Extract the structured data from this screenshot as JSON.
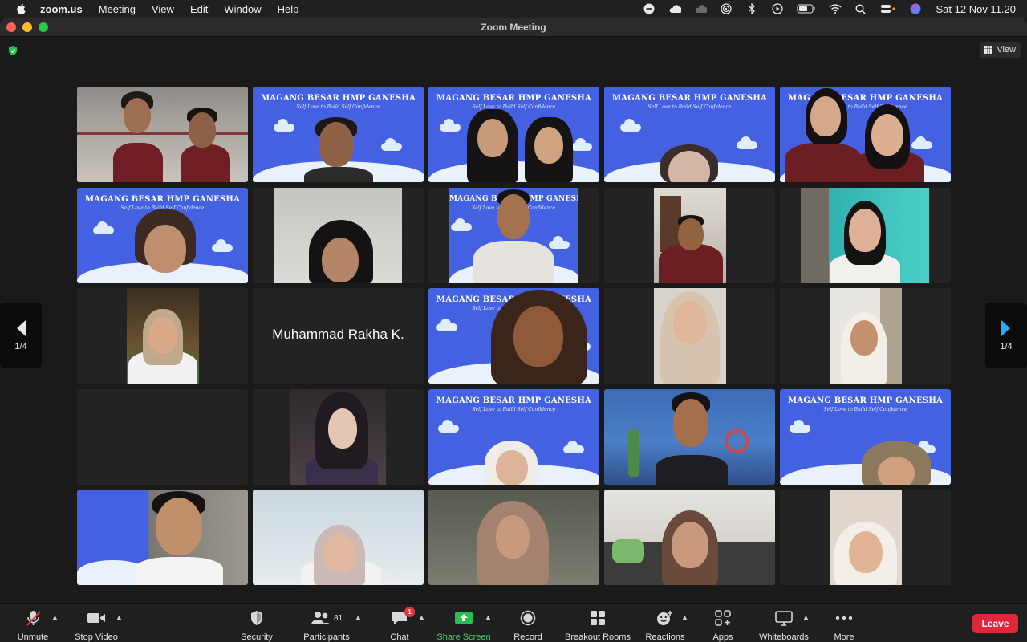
{
  "menubar": {
    "app_name": "zoom.us",
    "items": [
      "Meeting",
      "View",
      "Edit",
      "Window",
      "Help"
    ],
    "clock": "Sat 12 Nov  11.20"
  },
  "window": {
    "title": "Zoom Meeting"
  },
  "view_button": {
    "label": "View"
  },
  "pagination": {
    "prev_label": "1/4",
    "next_label": "1/4"
  },
  "tiles": {
    "name_only": "Muhammad Rakha K."
  },
  "banner": {
    "title": "MAGANG BESAR HMP GANESHA",
    "subtitle": "Self Love to Build Self Confidence"
  },
  "toolbar": {
    "unmute": "Unmute",
    "stop_video": "Stop Video",
    "security": "Security",
    "participants": "Participants",
    "participant_count": "81",
    "chat": "Chat",
    "chat_badge": "1",
    "share_screen": "Share Screen",
    "record": "Record",
    "breakout_rooms": "Breakout Rooms",
    "reactions": "Reactions",
    "apps": "Apps",
    "whiteboards": "Whiteboards",
    "more": "More",
    "leave": "Leave"
  },
  "colors": {
    "accent_green": "#23d959",
    "leave_red": "#e0263a",
    "banner_blue": "#4361e0"
  }
}
